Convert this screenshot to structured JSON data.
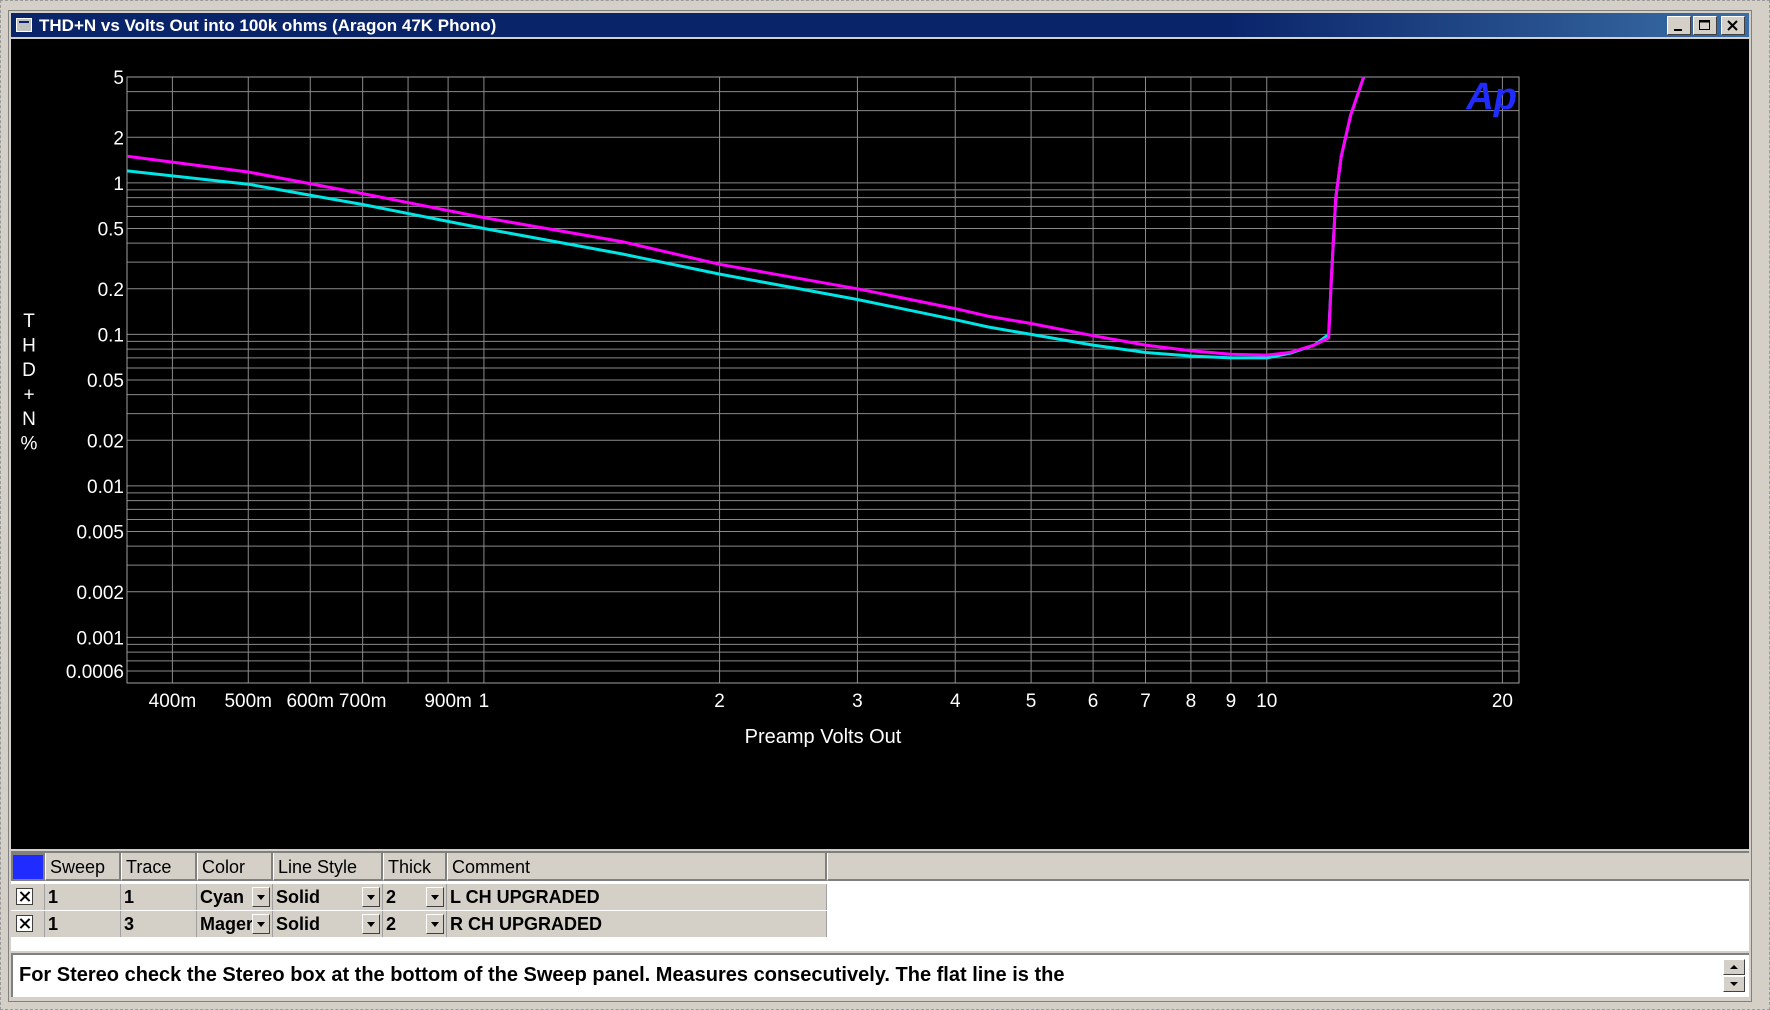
{
  "window": {
    "title": "THD+N vs Volts Out into 100k ohms (Aragon 47K Phono)"
  },
  "colors": {
    "titlebar": "#0a246a",
    "plot_background": "#000000",
    "grid": "#8a8a8a",
    "cyan_trace": "#00e6e6",
    "magenta_trace": "#ff00ff",
    "ap_logo": "#1f2bff"
  },
  "logo": {
    "text": "Ap"
  },
  "chart_data": {
    "type": "line",
    "xlabel": "Preamp Volts Out",
    "ylabel": "THD+N %",
    "x_scale": "log",
    "y_scale": "log",
    "xlim": [
      0.35,
      21
    ],
    "ylim": [
      0.0005,
      5.0
    ],
    "x_tick_labels": [
      {
        "v": 0.4,
        "t": "400m"
      },
      {
        "v": 0.5,
        "t": "500m"
      },
      {
        "v": 0.6,
        "t": "600m"
      },
      {
        "v": 0.7,
        "t": "700m"
      },
      {
        "v": 0.9,
        "t": "900m"
      },
      {
        "v": 1,
        "t": "1"
      },
      {
        "v": 2,
        "t": "2"
      },
      {
        "v": 3,
        "t": "3"
      },
      {
        "v": 4,
        "t": "4"
      },
      {
        "v": 5,
        "t": "5"
      },
      {
        "v": 6,
        "t": "6"
      },
      {
        "v": 7,
        "t": "7"
      },
      {
        "v": 8,
        "t": "8"
      },
      {
        "v": 9,
        "t": "9"
      },
      {
        "v": 10,
        "t": "10"
      },
      {
        "v": 20,
        "t": "20"
      }
    ],
    "y_tick_labels": [
      {
        "v": 5,
        "t": "5"
      },
      {
        "v": 2,
        "t": "2"
      },
      {
        "v": 1,
        "t": "1"
      },
      {
        "v": 0.5,
        "t": "0.5"
      },
      {
        "v": 0.2,
        "t": "0.2"
      },
      {
        "v": 0.1,
        "t": "0.1"
      },
      {
        "v": 0.05,
        "t": "0.05"
      },
      {
        "v": 0.02,
        "t": "0.02"
      },
      {
        "v": 0.01,
        "t": "0.01"
      },
      {
        "v": 0.005,
        "t": "0.005"
      },
      {
        "v": 0.002,
        "t": "0.002"
      },
      {
        "v": 0.001,
        "t": "0.001"
      },
      {
        "v": 0.0006,
        "t": "0.0006"
      }
    ],
    "grid": true,
    "series": [
      {
        "name": "L CH UPGRADED",
        "color": "#00e6e6",
        "x": [
          0.35,
          0.5,
          0.7,
          1.0,
          1.5,
          2.0,
          3.0,
          4.0,
          4.4,
          5.0,
          6.0,
          7.0,
          8.0,
          9.0,
          10.0,
          10.7,
          11.5,
          12.0,
          12.1,
          12.25,
          12.45,
          12.8,
          13.3
        ],
        "y": [
          1.2,
          0.98,
          0.72,
          0.5,
          0.34,
          0.25,
          0.17,
          0.125,
          0.112,
          0.1,
          0.085,
          0.076,
          0.072,
          0.07,
          0.07,
          0.075,
          0.085,
          0.1,
          0.25,
          0.8,
          1.5,
          2.8,
          5.0
        ]
      },
      {
        "name": "R CH UPGRADED",
        "color": "#ff00ff",
        "x": [
          0.35,
          0.5,
          0.7,
          1.0,
          1.5,
          2.0,
          3.0,
          4.0,
          4.4,
          5.0,
          6.0,
          7.0,
          8.0,
          9.0,
          10.0,
          10.7,
          11.5,
          12.0,
          12.1,
          12.25,
          12.45,
          12.8,
          13.3
        ],
        "y": [
          1.5,
          1.18,
          0.85,
          0.59,
          0.41,
          0.29,
          0.2,
          0.148,
          0.132,
          0.118,
          0.098,
          0.085,
          0.078,
          0.074,
          0.073,
          0.076,
          0.085,
          0.095,
          0.25,
          0.8,
          1.5,
          2.8,
          5.0
        ]
      }
    ]
  },
  "legend_table": {
    "headers": {
      "sweep": "Sweep",
      "trace": "Trace",
      "color": "Color",
      "line_style": "Line Style",
      "thick": "Thick",
      "comment": "Comment"
    },
    "rows": [
      {
        "sweep": "1",
        "trace": "1",
        "color": "Cyan",
        "line_style": "Solid",
        "thick": "2",
        "comment": "L CH UPGRADED"
      },
      {
        "sweep": "1",
        "trace": "3",
        "color": "Mager",
        "line_style": "Solid",
        "thick": "2",
        "comment": "R CH UPGRADED"
      }
    ]
  },
  "status": {
    "text": "For Stereo check the Stereo box at the bottom of the Sweep panel.  Measures consecutively.  The flat line is the"
  }
}
